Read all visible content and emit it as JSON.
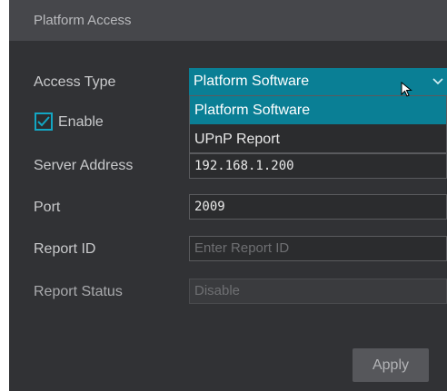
{
  "header": {
    "title": "Platform Access"
  },
  "form": {
    "access_type": {
      "label": "Access Type",
      "value": "Platform Software"
    },
    "dropdown_options": [
      "Platform Software",
      "UPnP Report"
    ],
    "enable": {
      "label": "Enable",
      "checked": true
    },
    "server_address": {
      "label": "Server Address",
      "value": "192.168.1.200"
    },
    "port": {
      "label": "Port",
      "value": "2009"
    },
    "report_id": {
      "label": "Report ID",
      "placeholder": "Enter Report ID"
    },
    "report_status": {
      "label": "Report Status",
      "value": "Disable"
    }
  },
  "apply_label": "Apply",
  "colors": {
    "accent": "#0a7f95",
    "panel": "#313235",
    "header": "#46474b"
  },
  "icons": {
    "dropdown": "chevron-down-icon",
    "checkbox": "check-icon",
    "pointer": "mouse-cursor-icon"
  }
}
